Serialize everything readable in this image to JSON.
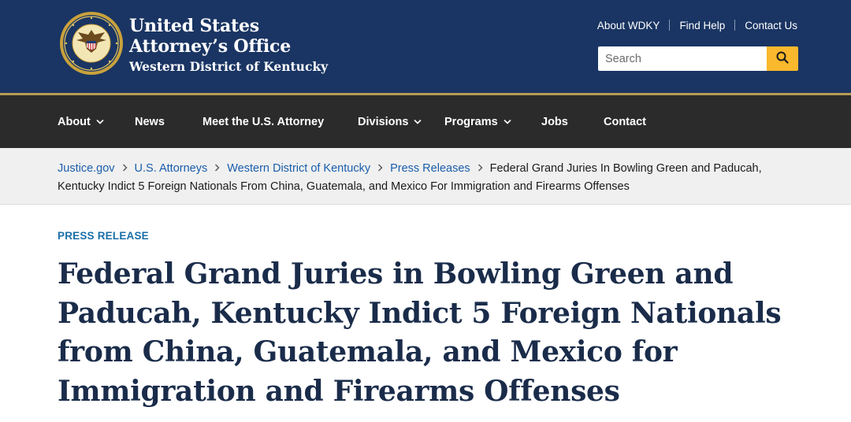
{
  "header": {
    "agency_line1": "United States",
    "agency_line2": "Attorney’s Office",
    "district": "Western District of Kentucky",
    "seal_icon": "doj-seal-icon",
    "colors": {
      "header_bg": "#1a3563",
      "accent": "#fab82c",
      "gold_strip": "#b89a53"
    }
  },
  "utility_links": [
    "About WDKY",
    "Find Help",
    "Contact Us"
  ],
  "search": {
    "placeholder": "Search",
    "button_icon": "search-icon"
  },
  "nav": {
    "items": [
      {
        "label": "About",
        "has_dropdown": true
      },
      {
        "label": "News",
        "has_dropdown": false
      },
      {
        "label": "Meet the U.S. Attorney",
        "has_dropdown": false
      },
      {
        "label": "Divisions",
        "has_dropdown": true
      },
      {
        "label": "Programs",
        "has_dropdown": true
      },
      {
        "label": "Jobs",
        "has_dropdown": false
      },
      {
        "label": "Contact",
        "has_dropdown": false
      }
    ],
    "colors": {
      "nav_bg": "#2b2b2b"
    }
  },
  "breadcrumb": {
    "links": [
      "Justice.gov",
      "U.S. Attorneys",
      "Western District of Kentucky",
      "Press Releases"
    ],
    "current": "Federal Grand Juries In Bowling Green and Paducah, Kentucky Indict 5 Foreign Nationals From China, Guatemala, and Mexico For Immigration and Firearms Offenses"
  },
  "article": {
    "eyebrow": "PRESS RELEASE",
    "title": "Federal Grand Juries in Bowling Green and Paducah, Kentucky Indict 5 Foreign Nationals from China, Guatemala, and Mexico for Immigration and Firearms Offenses"
  }
}
